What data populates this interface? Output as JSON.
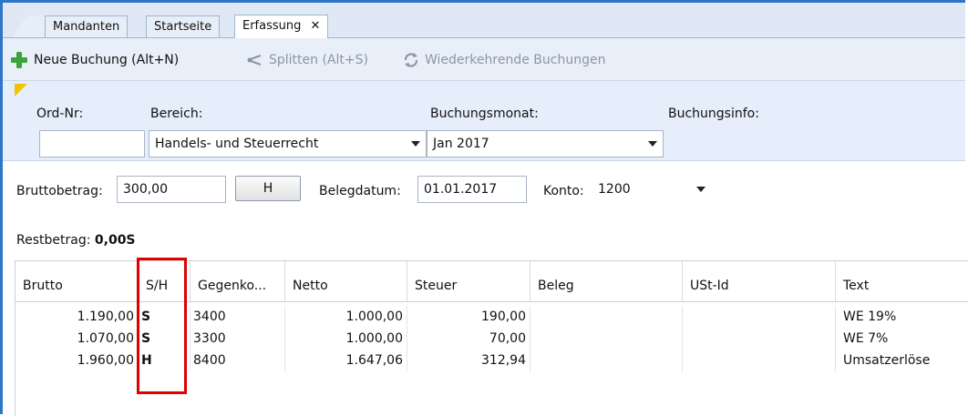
{
  "tabs": [
    {
      "label": "Mandanten"
    },
    {
      "label": "Startseite"
    },
    {
      "label": "Erfassung",
      "close": "✕"
    }
  ],
  "toolbar": {
    "new_booking": "Neue Buchung (Alt+N)",
    "split": "Splitten (Alt+S)",
    "recurring": "Wiederkehrende Buchungen"
  },
  "header": {
    "ord_label": "Ord-Nr:",
    "ord_value": "",
    "bereich_label": "Bereich:",
    "bereich_value": "Handels- und Steuerrecht",
    "monat_label": "Buchungsmonat:",
    "monat_value": "Jan 2017",
    "info_label": "Buchungsinfo:"
  },
  "row2": {
    "brutto_label": "Bruttobetrag:",
    "brutto_value": "300,00",
    "sh_button": "H",
    "beleg_label": "Belegdatum:",
    "beleg_value": "01.01.2017",
    "konto_label": "Konto:",
    "konto_value": "1200",
    "rest_label": "Restbetrag:",
    "rest_value": "0,00S"
  },
  "grid": {
    "columns": [
      "Brutto",
      "S/H",
      "Gegenko...",
      "Netto",
      "Steuer",
      "Beleg",
      "USt-Id",
      "Text"
    ],
    "rows": [
      {
        "brutto": "1.190,00",
        "sh": "S",
        "gegenkonto": "3400",
        "netto": "1.000,00",
        "steuer": "190,00",
        "beleg": "",
        "ustid": "",
        "text": "WE 19%"
      },
      {
        "brutto": "1.070,00",
        "sh": "S",
        "gegenkonto": "3300",
        "netto": "1.000,00",
        "steuer": "70,00",
        "beleg": "",
        "ustid": "",
        "text": "WE 7%"
      },
      {
        "brutto": "1.960,00",
        "sh": "H",
        "gegenkonto": "8400",
        "netto": "1.647,06",
        "steuer": "312,94",
        "beleg": "",
        "ustid": "",
        "text": "Umsatzerlöse"
      }
    ]
  },
  "colors": {
    "accent_border": "#2f75c8",
    "highlight": "#e00000",
    "add_icon": "#3aa43a"
  },
  "icons": [
    "add-icon",
    "split-icon",
    "recurring-icon",
    "pencil-icon",
    "close-icon",
    "chevron-down-icon"
  ]
}
